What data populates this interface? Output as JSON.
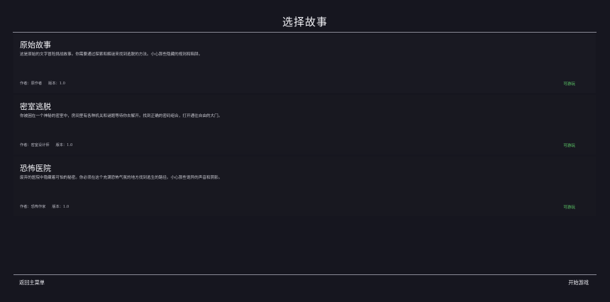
{
  "page": {
    "title": "选择故事"
  },
  "stories": [
    {
      "name": "原始故事",
      "description": "这是原始的文字冒险挑战故事。你需要通过探索和解谜来找到逃脱的方法。小心那些隐藏的规则和陷阱。",
      "author_label": "作者：原作者",
      "version_label": "版本：1.0",
      "status": "可游玩"
    },
    {
      "name": "密室逃脱",
      "description": "你被困在一个神秘的密室中，房间里有各种机关和谜题等待你去解开。找到正确的密码组合，打开通往自由的大门。",
      "author_label": "作者：密室设计师",
      "version_label": "版本：1.0",
      "status": "可游玩"
    },
    {
      "name": "恐怖医院",
      "description": "废弃的医院中隐藏着可怕的秘密。你必须在这个充满恐怖气氛的地方找到逃生的路径。小心那些诡异的声音和阴影。",
      "author_label": "作者：恐怖作家",
      "version_label": "版本：1.0",
      "status": "可游玩"
    }
  ],
  "footer": {
    "back_label": "返回主菜单",
    "start_label": "开始游戏"
  },
  "colors": {
    "background": "#16161f",
    "card": "#181820",
    "status_green": "#5fd06a",
    "rule": "#8a8a96"
  }
}
